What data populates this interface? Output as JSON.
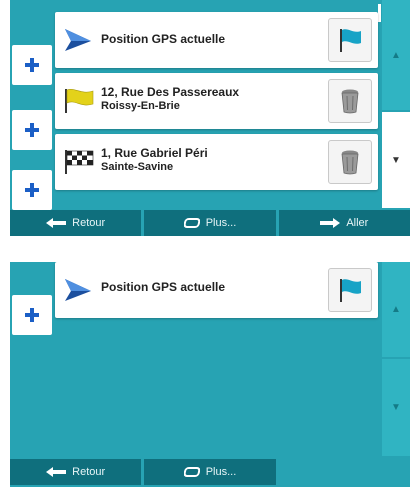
{
  "top_screen": {
    "rows": [
      {
        "line1": "Position GPS actuelle",
        "line2": "",
        "icon": "gps-position-icon",
        "action_icon": "flag-icon"
      },
      {
        "line1": "12, Rue Des Passereaux",
        "line2": "Roissy-En-Brie",
        "icon": "yellow-flag-icon",
        "action_icon": "trash-icon"
      },
      {
        "line1": "1, Rue Gabriel Péri",
        "line2": "Sainte-Savine",
        "icon": "checkered-flag-icon",
        "action_icon": "trash-icon"
      }
    ],
    "add_icon": "plus-icon",
    "scroll_up_icon": "chevron-up-icon",
    "scroll_down_icon": "chevron-down-icon",
    "bottom_bar": {
      "back_label": "Retour",
      "more_label": "Plus...",
      "go_label": "Aller"
    }
  },
  "bottom_screen": {
    "rows": [
      {
        "line1": "Position GPS actuelle",
        "line2": "",
        "icon": "gps-position-icon",
        "action_icon": "flag-icon"
      }
    ],
    "add_icon": "plus-icon",
    "scroll_up_icon": "chevron-up-icon",
    "scroll_down_icon": "chevron-down-icon",
    "bottom_bar": {
      "back_label": "Retour",
      "more_label": "Plus..."
    }
  },
  "colors": {
    "background": "#27a3b3",
    "bar": "#0f6f7d",
    "accent_blue": "#1b5fc6"
  }
}
